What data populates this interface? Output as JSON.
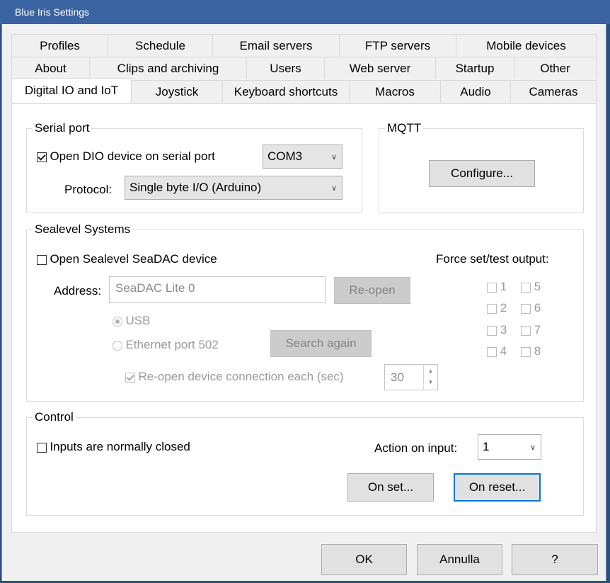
{
  "window": {
    "title": "Blue Iris Settings"
  },
  "tabs": {
    "row1": [
      "Profiles",
      "Schedule",
      "Email servers",
      "FTP servers",
      "Mobile devices"
    ],
    "row2": [
      "About",
      "Clips and archiving",
      "Users",
      "Web server",
      "Startup",
      "Other"
    ],
    "row3": [
      "Digital IO and IoT",
      "Joystick",
      "Keyboard shortcuts",
      "Macros",
      "Audio",
      "Cameras"
    ],
    "active": "Digital IO and IoT"
  },
  "serial_port": {
    "title": "Serial port",
    "open_label": "Open DIO device on serial port",
    "open_checked": true,
    "port_value": "COM3",
    "protocol_label": "Protocol:",
    "protocol_value": "Single byte I/O (Arduino)"
  },
  "mqtt": {
    "title": "MQTT",
    "configure_label": "Configure..."
  },
  "sealevel": {
    "title": "Sealevel Systems",
    "open_label": "Open Sealevel SeaDAC device",
    "open_checked": false,
    "force_label": "Force set/test output:",
    "address_label": "Address:",
    "address_value": "SeaDAC Lite 0",
    "reopen_label": "Re-open",
    "usb_label": "USB",
    "ethernet_label": "Ethernet port 502",
    "search_label": "Search again",
    "reopen_each_label": "Re-open device connection each (sec)",
    "reopen_each_checked": true,
    "reopen_each_value": "30",
    "outputs": [
      "1",
      "5",
      "2",
      "6",
      "3",
      "7",
      "4",
      "8"
    ]
  },
  "control": {
    "title": "Control",
    "normally_closed_label": "Inputs are normally closed",
    "normally_closed_checked": false,
    "action_label": "Action on input:",
    "action_value": "1",
    "on_set_label": "On set...",
    "on_reset_label": "On reset..."
  },
  "footer": {
    "ok_label": "OK",
    "cancel_label": "Annulla",
    "help_label": "?"
  }
}
